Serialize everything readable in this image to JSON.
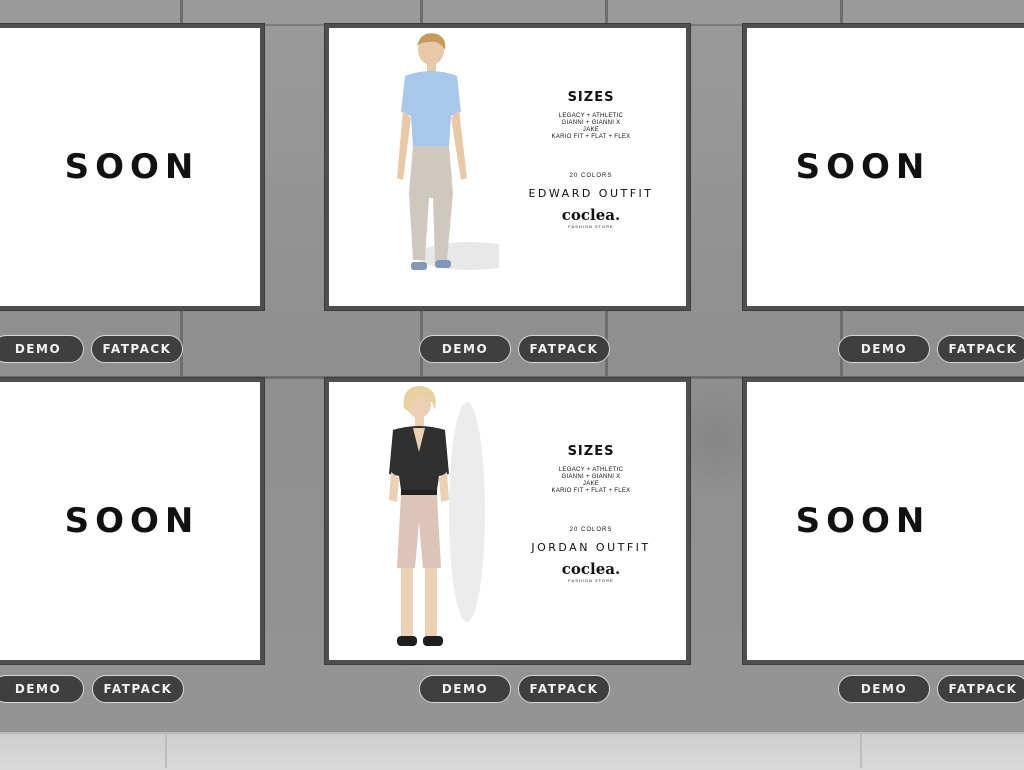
{
  "buttons": {
    "demo": "DEMO",
    "fatpack": "FATPACK"
  },
  "soon_label": "SOON",
  "products": [
    {
      "sizes_title": "SIZES",
      "sizes_lines": [
        "LEGACY + ATHLETIC",
        "GIANNI + GIANNI X",
        "JAKE",
        "KARIO FIT + FLAT + FLEX"
      ],
      "colors": "20 COLORS",
      "name": "EDWARD OUTFIT",
      "brand": "coclea.",
      "brand_sub": "FASHION STORE"
    },
    {
      "sizes_title": "SIZES",
      "sizes_lines": [
        "LEGACY + ATHLETIC",
        "GIANNI + GIANNI X",
        "JAKE",
        "KARIO FIT + FLAT + FLEX"
      ],
      "colors": "20 COLORS",
      "name": "JORDAN OUTFIT",
      "brand": "coclea.",
      "brand_sub": "FASHION STORE"
    }
  ],
  "colors": {
    "button_bg": "#3f3f3f",
    "button_border": "#d6d6d6",
    "poster_frame": "#4f4f4f",
    "wall": "#909090"
  }
}
